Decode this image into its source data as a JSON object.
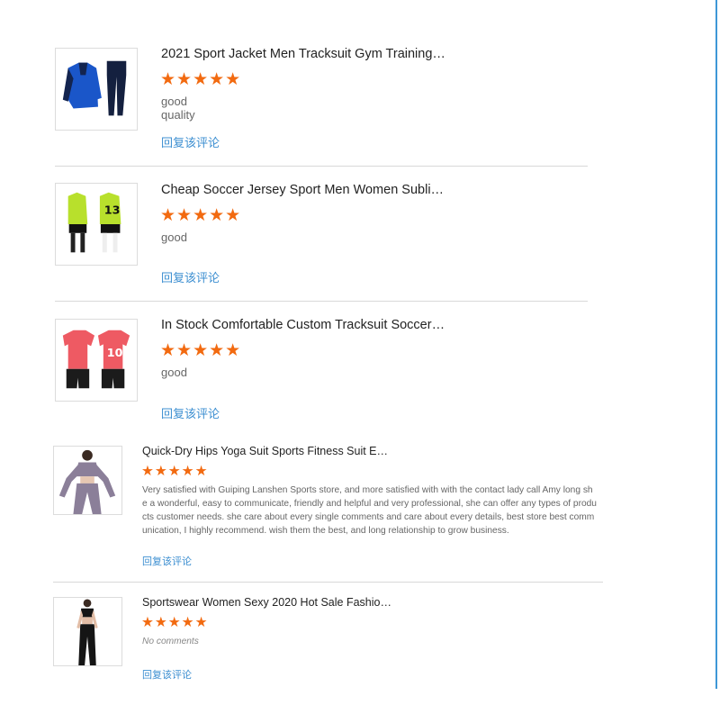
{
  "reviews": [
    {
      "title": "2021 Sport Jacket Men Tracksuit Gym Training…",
      "stars": "★★★★★",
      "rating": 5,
      "comment": "good quality",
      "reply": "回复该评论",
      "image_icon": "tracksuit-product-image"
    },
    {
      "title": "Cheap Soccer Jersey Sport Men Women Subli…",
      "stars": "★★★★★",
      "rating": 5,
      "comment": "good",
      "reply": "回复该评论",
      "image_icon": "soccer-jersey-product-image"
    },
    {
      "title": "In Stock Comfortable Custom Tracksuit Soccer…",
      "stars": "★★★★★",
      "rating": 5,
      "comment": "good",
      "reply": "回复该评论",
      "image_icon": "red-soccer-kit-product-image"
    },
    {
      "title": "Quick-Dry Hips Yoga Suit Sports Fitness Suit E…",
      "stars": "★★★★★",
      "rating": 5,
      "comment": "Very satisfied with Guiping Lanshen Sports store, and more satisfied with with the contact lady call Amy long she a wonderful, easy to communicate, friendly and helpful and very professional, she can offer any types of products customer needs. she care about every single comments and care about every details, best store best communication, I highly recommend. wish them the best, and long relationship to grow business.",
      "reply": "回复该评论",
      "image_icon": "yoga-suit-product-image"
    },
    {
      "title": "Sportswear Women Sexy 2020 Hot Sale Fashio…",
      "stars": "★★★★★",
      "rating": 5,
      "comment": "No comments",
      "reply": "回复该评论",
      "image_icon": "sportswear-women-product-image"
    }
  ],
  "colors": {
    "star": "#f26a10",
    "reply_link": "#3d8fd1",
    "divider": "#d9d9d9",
    "right_rule": "#3d97d6"
  }
}
